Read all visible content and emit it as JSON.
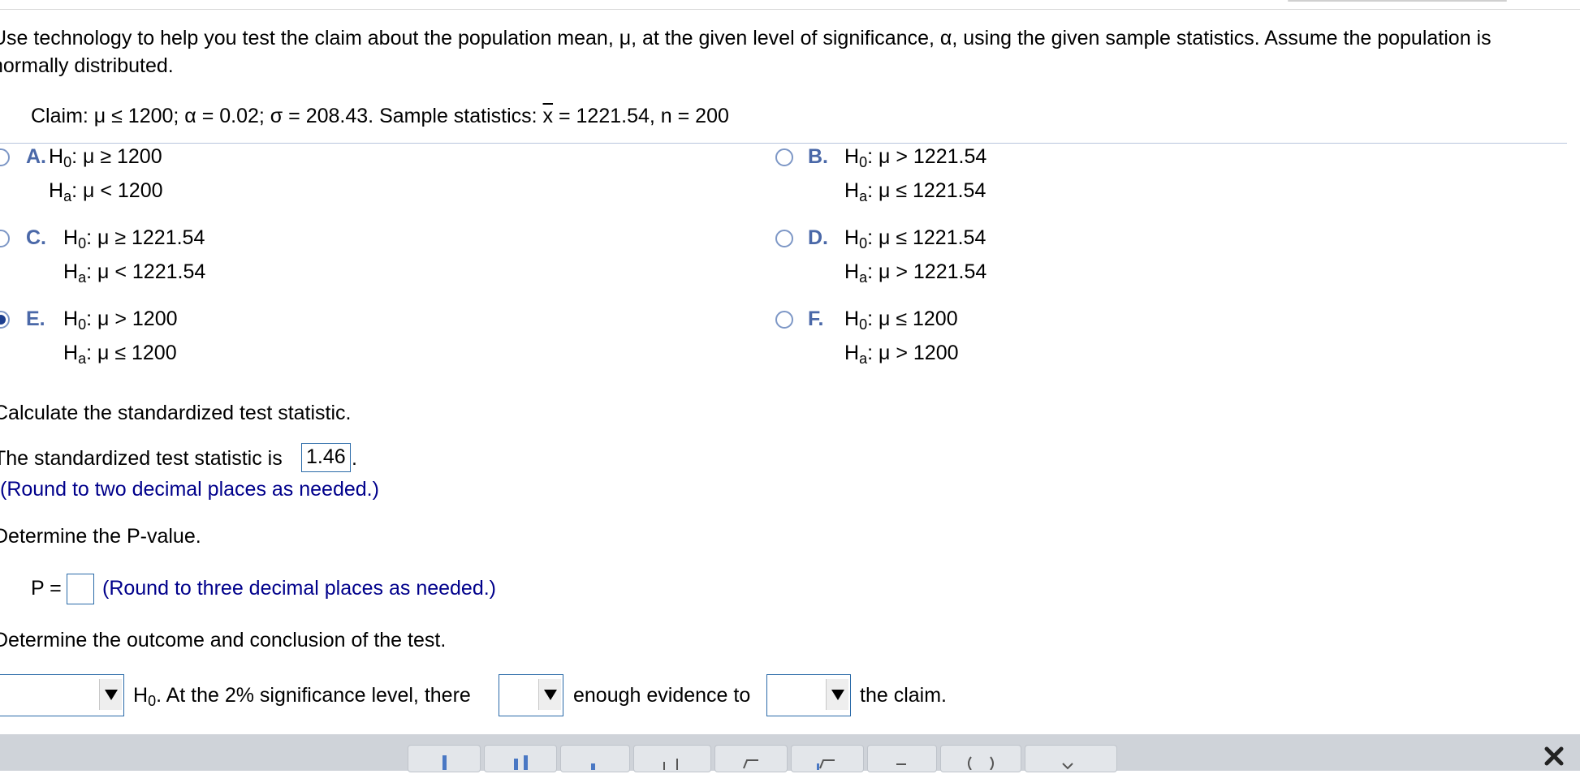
{
  "question": {
    "line1": "Use technology to help you test the claim about the population mean, μ, at the given level of significance, α, using the given sample statistics. Assume the population is",
    "line2": "normally distributed.",
    "claim_prefix": "Claim: μ ≤ 1200; α = 0.02; σ = 208.43. Sample statistics: ",
    "xbar_symbol": "x",
    "claim_suffix": " = 1221.54, n = 200"
  },
  "options": [
    {
      "letter": "A.",
      "h0": "μ ≥ 1200",
      "ha": "μ < 1200",
      "selected": false
    },
    {
      "letter": "B.",
      "h0": "μ > 1221.54",
      "ha": "μ ≤ 1221.54",
      "selected": false
    },
    {
      "letter": "C.",
      "h0": "μ ≥ 1221.54",
      "ha": "μ < 1221.54",
      "selected": false
    },
    {
      "letter": "D.",
      "h0": "μ ≤ 1221.54",
      "ha": "μ > 1221.54",
      "selected": false
    },
    {
      "letter": "E.",
      "h0": "μ > 1200",
      "ha": "μ ≤ 1200",
      "selected": true
    },
    {
      "letter": "F.",
      "h0": "μ ≤ 1200",
      "ha": "μ > 1200",
      "selected": false
    }
  ],
  "hypothesis": {
    "h": "H",
    "sub0": "0",
    "suba": "a",
    "colon": ":"
  },
  "step2": {
    "prompt": "Calculate the standardized test statistic.",
    "answer_prefix": "The standardized test statistic is ",
    "answer_value": "1.46",
    "answer_suffix": ".",
    "hint": "(Round to two decimal places as needed.)"
  },
  "step3": {
    "prompt": "Determine the P-value.",
    "label": "P =",
    "hint": "(Round to three decimal places as needed.)"
  },
  "step4": {
    "prompt": "Determine the outcome and conclusion of the test.",
    "h": "H",
    "sub": "0",
    "text1": ". At the 2% significance level, there",
    "text2": "enough evidence to",
    "text3": "the claim."
  },
  "icons": {
    "dropdown": "dropdown-arrow-icon",
    "close": "close-icon"
  },
  "colors": {
    "option_letter": "#4a68a8",
    "hint": "#00008b",
    "input_border": "#2a6aa8",
    "radio_selected": "#1d3f8f"
  }
}
